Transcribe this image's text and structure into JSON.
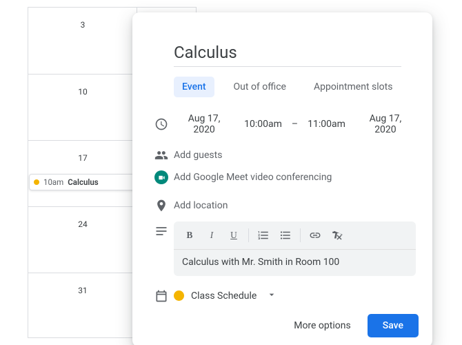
{
  "grid": {
    "days": [
      "3",
      "10",
      "17",
      "24",
      "31"
    ],
    "event_chip": {
      "time": "10am",
      "title": "Calculus"
    }
  },
  "dialog": {
    "title": "Calculus",
    "tabs": {
      "event": "Event",
      "out_of_office": "Out of office",
      "appointment_slots": "Appointment slots"
    },
    "datetime": {
      "start_date": "Aug 17, 2020",
      "start_time": "10:00am",
      "dash": "–",
      "end_time": "11:00am",
      "end_date": "Aug 17, 2020"
    },
    "guests_placeholder": "Add guests",
    "meet_placeholder": "Add Google Meet video conferencing",
    "location_placeholder": "Add location",
    "description": "Calculus with Mr. Smith in Room 100",
    "calendar": {
      "name": "Class Schedule",
      "color": "#f4b400"
    },
    "footer": {
      "more_options": "More options",
      "save": "Save"
    },
    "toolbar_labels": {
      "bold": "B",
      "italic": "I",
      "underline": "U"
    }
  }
}
